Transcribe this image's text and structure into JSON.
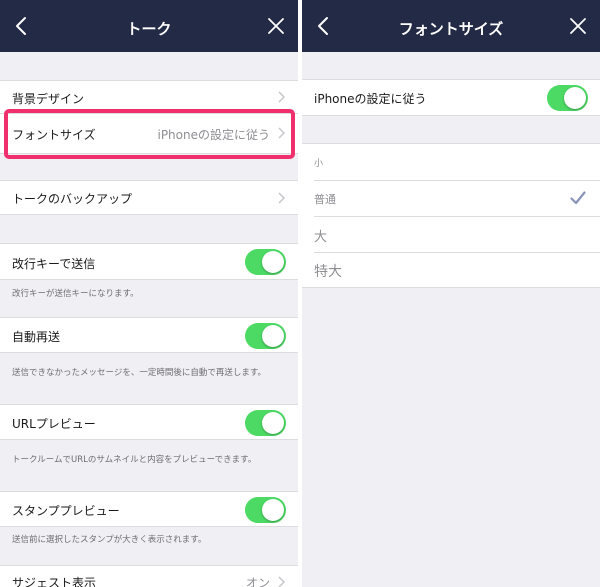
{
  "left": {
    "title": "トーク",
    "rows": {
      "bg_design": {
        "label": "背景デザイン"
      },
      "font_size": {
        "label": "フォントサイズ",
        "value": "iPhoneの設定に従う"
      },
      "backup": {
        "label": "トークのバックアップ"
      },
      "enter_send": {
        "label": "改行キーで送信",
        "desc": "改行キーが送信キーになります。",
        "on": true
      },
      "auto_resend": {
        "label": "自動再送",
        "desc": "送信できなかったメッセージを、一定時間後に自動で再送します。",
        "on": true
      },
      "url_preview": {
        "label": "URLプレビュー",
        "desc": "トークルームでURLのサムネイルと内容をプレビューできます。",
        "on": true
      },
      "stamp_preview": {
        "label": "スタンププレビュー",
        "desc": "送信前に選択したスタンプが大きく表示されます。",
        "on": true
      },
      "suggest": {
        "label": "サジェスト表示",
        "value": "オン"
      }
    }
  },
  "right": {
    "title": "フォントサイズ",
    "follow_iphone": {
      "label": "iPhoneの設定に従う",
      "on": true
    },
    "options": [
      "小",
      "普通",
      "大",
      "特大"
    ],
    "selected_option": "普通"
  },
  "colors": {
    "navbar": "#232a45",
    "toggle_on": "#4cd964",
    "highlight": "#f0306e",
    "background": "#efeff4"
  },
  "icons": {
    "back": "chevron-left-icon",
    "close": "close-icon",
    "row": "chevron-right-icon",
    "selected": "checkmark-icon"
  }
}
